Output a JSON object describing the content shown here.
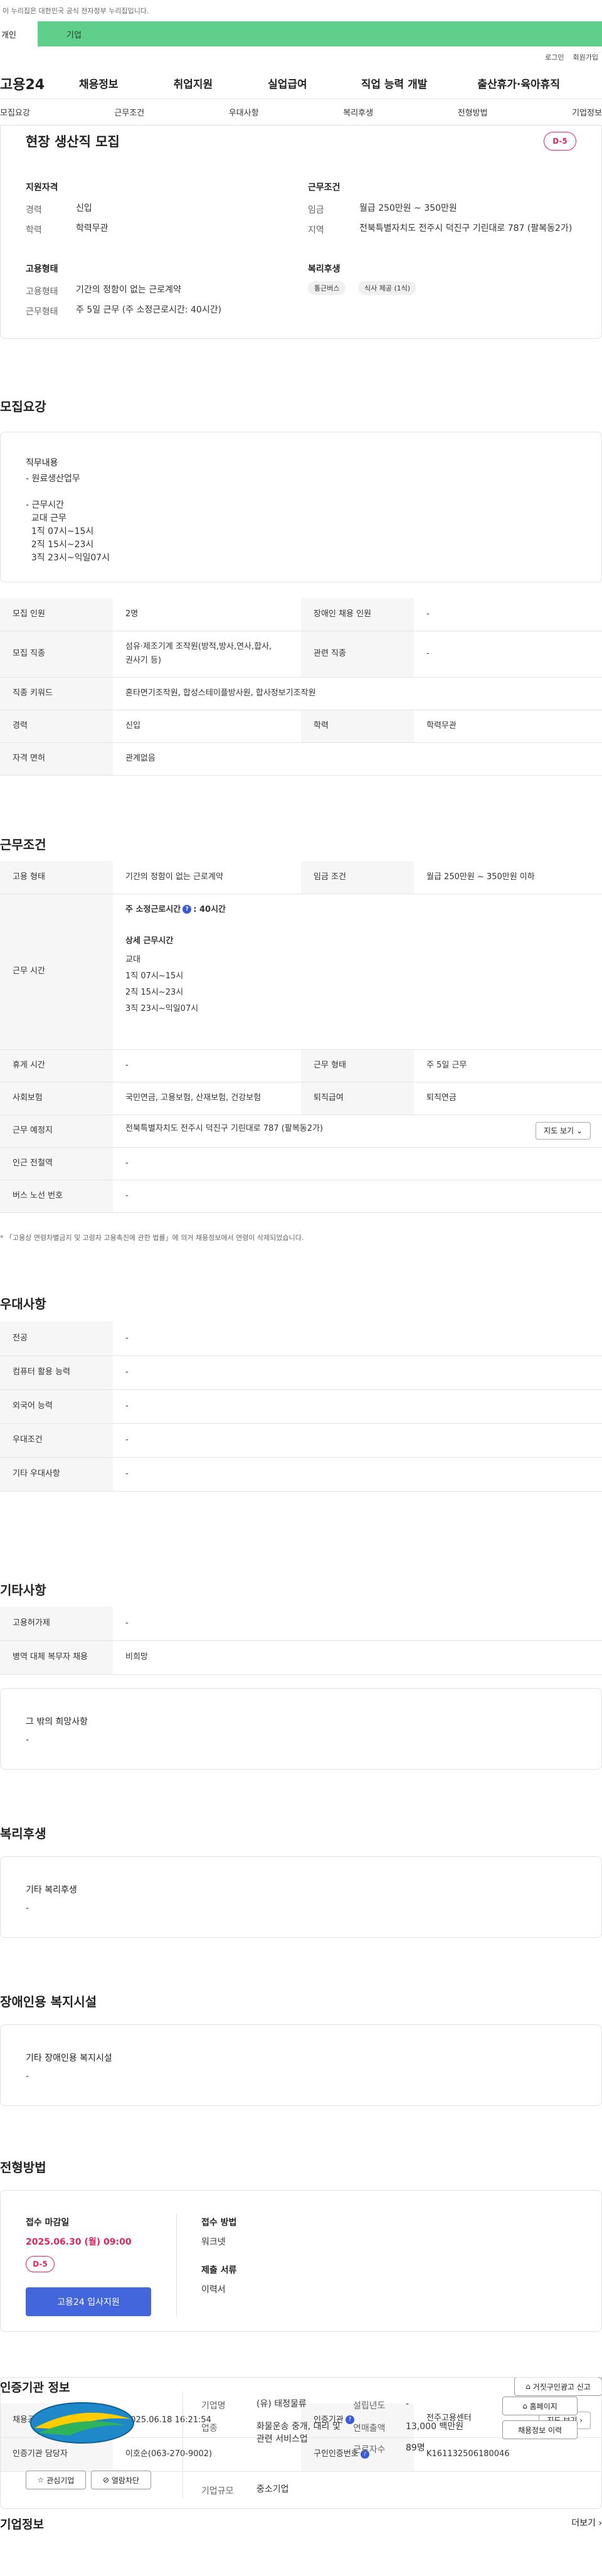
{
  "gov_banner": "이 누리집은 대한민국 공식 전자정부 누리집입니다.",
  "gnb_tabs": [
    "개인",
    "기업"
  ],
  "util": [
    "로그인",
    "회원가입"
  ],
  "logo": "고용24",
  "mainnav": [
    "채용정보",
    "취업지원",
    "실업급여",
    "직업 능력 개발",
    "출산휴가·육아휴직"
  ],
  "subnav": [
    "모집요강",
    "근무조건",
    "우대사항",
    "복리후생",
    "전형방법",
    "기업정보"
  ],
  "summary": {
    "title": "현장 생산직 모집",
    "dday": "D-5",
    "qual_head": "지원자격",
    "career_k": "경력",
    "career_v": "신입",
    "edu_k": "학력",
    "edu_v": "학력무관",
    "cond_head": "근무조건",
    "wage_k": "임금",
    "wage_v": "월급 250만원 ~ 350만원",
    "region_k": "지역",
    "region_v": "전북특별자치도 전주시 덕진구 기린대로 787 (팔복동2가)",
    "emp_head": "고용형태",
    "emptype_k": "고용형태",
    "emptype_v": "기간의 정함이 없는 근로계약",
    "worktype_k": "근무형태",
    "worktype_v": "주 5일 근무 (주 소정근로시간: 40시간)",
    "welfare_head": "복리후생",
    "chips": [
      "통근버스",
      "식사 제공 (1식)"
    ]
  },
  "recruit": {
    "title": "모집요강",
    "duty_label": "직무내용",
    "duty_text": "- 원료생산업무\n\n- 근무시간\n  교대 근무\n  1직 07시~15시\n  2직 15시~23시\n  3직 23시~익일07시",
    "rows": [
      {
        "k1": "모집 인원",
        "v1": "2명",
        "k2": "장애인 채용 인원",
        "v2": "-"
      },
      {
        "k1": "모집 직종",
        "v1": "섬유·제조기계 조작원(방적,방사,연사,합사,\n권사기 등)",
        "k2": "관련 직종",
        "v2": "-"
      },
      {
        "k1": "직종 키워드",
        "v1": "혼타면기조작원, 합성스테이플방사원, 합사정보기조작원"
      },
      {
        "k1": "경력",
        "v1": "신입",
        "k2": "학력",
        "v2": "학력무관"
      },
      {
        "k1": "자격 면허",
        "v1": "관계없음"
      }
    ]
  },
  "work": {
    "title": "근무조건",
    "emp_k": "고용 형태",
    "emp_v": "기간의 정함이 없는 근로계약",
    "wage_k": "임금 조건",
    "wage_v": "월급 250만원 ~ 350만원 이하",
    "hours_k": "근무 시간",
    "hours_week": "주 소정근로시간",
    "hours_week_v": ": 40시간",
    "hours_detail_head": "상세 근무시간",
    "hours_detail": "교대\n1직 07시~15시\n2직 15시~23시\n3직 23시~익일07시",
    "break_k": "휴게 시간",
    "break_v": "-",
    "form_k": "근무 형태",
    "form_v": "주 5일 근무",
    "ins_k": "사회보험",
    "ins_v": "국민연금, 고용보험, 산재보험, 건강보험",
    "ret_k": "퇴직급여",
    "ret_v": "퇴직연금",
    "loc_k": "근무 예정지",
    "loc_v": "전북특별자치도 전주시 덕진구 기린대로 787 (팔복동2가)",
    "map_btn": "지도 보기",
    "metro_k": "인근 전철역",
    "metro_v": "-",
    "bus_k": "버스 노선 번호",
    "bus_v": "-",
    "note": "* 「고용상 연령차별금지 및 고령자 고용촉진에 관한 법률」에 의거 채용정보에서 연령이 삭제되었습니다."
  },
  "pref": {
    "title": "우대사항",
    "rows": [
      [
        "전공",
        "-"
      ],
      [
        "컴퓨터 활용 능력",
        "-"
      ],
      [
        "외국어 능력",
        "-"
      ],
      [
        "우대조건",
        "-"
      ],
      [
        "기타 우대사항",
        "-"
      ]
    ]
  },
  "etc": {
    "title": "기타사항",
    "rows": [
      [
        "고용허가제",
        "-"
      ],
      [
        "병역 대체 복무자 채용",
        "비희망"
      ]
    ],
    "other_label": "그 밖의 희망사항",
    "other_v": "-"
  },
  "welfare": {
    "title": "복리후생",
    "label": "기타 복리후생",
    "v": "-"
  },
  "disabled": {
    "title": "장애인용 복지시설",
    "label": "기타 장애인용 복지시설",
    "v": "-"
  },
  "screening": {
    "title": "전형방법",
    "deadline_label": "접수 마감일",
    "deadline": "2025.06.30 (월) 09:00",
    "dday": "D-5",
    "apply_btn": "고용24 입사지원",
    "method_label": "접수 방법",
    "method_v": "워크넷",
    "docs_label": "제출 서류",
    "docs_v": "이력서"
  },
  "agency": {
    "title": "인증기관 정보",
    "report_btn": "거짓구인광고 신고",
    "reg_k": "채용공고 등록일시",
    "reg_v": "2025.06.18 16:21:54",
    "org_k": "인증기관",
    "org_v": "전주고용센터",
    "map_btn": "지도 보기",
    "mgr_k": "인증기관 담당자",
    "mgr_v": "이호순(063-270-9002)",
    "cert_k": "구인인증번호",
    "cert_v": "K161132506180046"
  },
  "company": {
    "title": "기업정보",
    "more": "더보기",
    "fav_btn": "관심기업",
    "block_btn": "열람차단",
    "name_k": "기업명",
    "name_v": "(유) 태정물류",
    "ind_k": "업종",
    "ind_v": "화물운송 중개, 대리 및 관련 서비스업",
    "year_k": "설립년도",
    "year_v": "-",
    "sales_k": "연매출액",
    "sales_v": "13,000 백만원",
    "emp_k": "근로자수",
    "emp_v": "89명",
    "size_k": "기업규모",
    "size_v": "중소기업",
    "home_btn": "홈페이지",
    "jobs_btn": "채용정보 이력"
  }
}
